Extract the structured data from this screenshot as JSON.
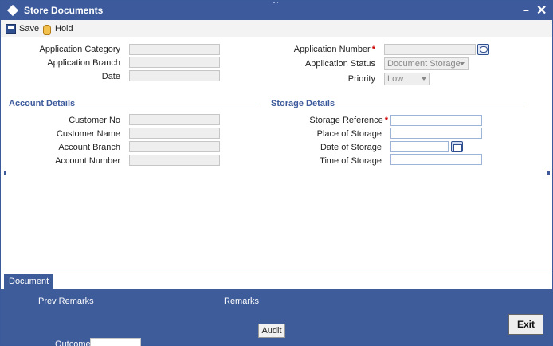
{
  "window": {
    "title": "Store Documents"
  },
  "toolbar": {
    "save_label": "Save",
    "hold_label": "Hold"
  },
  "header": {
    "app_category_label": "Application Category",
    "app_branch_label": "Application Branch",
    "date_label": "Date",
    "app_number_label": "Application Number",
    "app_status_label": "Application Status",
    "app_status_value": "Document Storage",
    "priority_label": "Priority",
    "priority_value": "Low"
  },
  "account": {
    "section_title": "Account Details",
    "customer_no_label": "Customer No",
    "customer_name_label": "Customer Name",
    "account_branch_label": "Account Branch",
    "account_number_label": "Account Number"
  },
  "storage": {
    "section_title": "Storage Details",
    "reference_label": "Storage Reference",
    "place_label": "Place of Storage",
    "date_label": "Date of Storage",
    "time_label": "Time of Storage"
  },
  "tabs": {
    "document": "Document"
  },
  "footer": {
    "prev_remarks": "Prev Remarks",
    "remarks": "Remarks",
    "audit": "Audit",
    "exit": "Exit",
    "outcome": "Outcome"
  },
  "required_mark": "*",
  "colors": {
    "accent": "#3d5b9c",
    "required": "#cc0000"
  }
}
